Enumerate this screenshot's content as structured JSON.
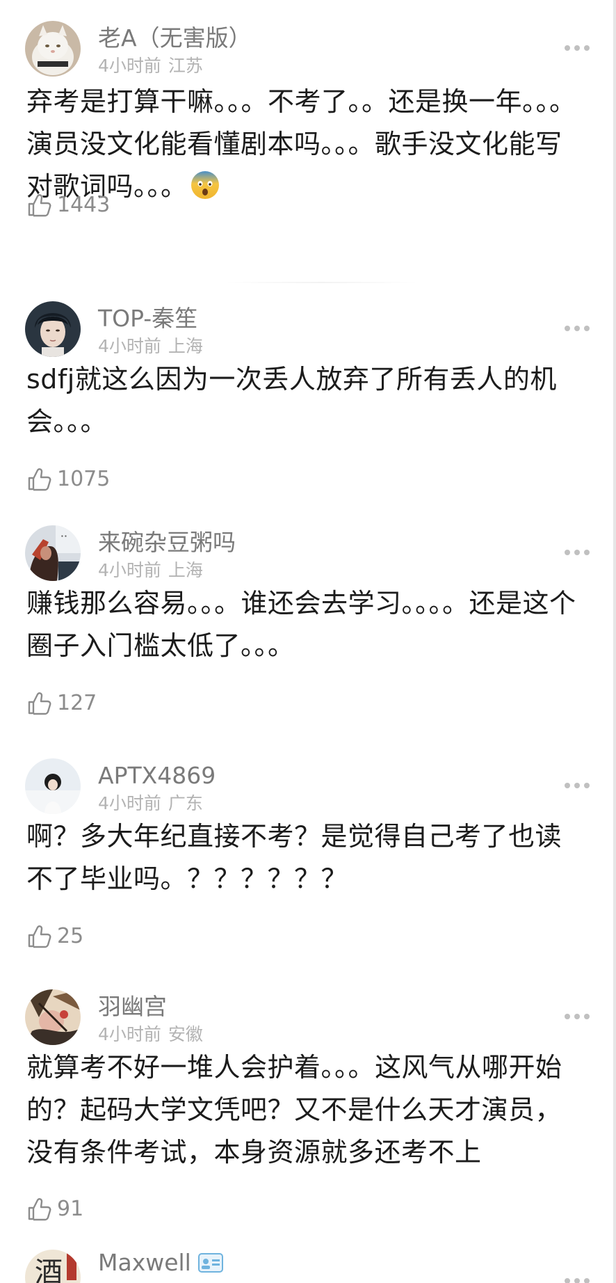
{
  "comments": [
    {
      "username": "老A（无害版）",
      "time": "4小时前",
      "location": "江苏",
      "text": "弃考是打算干嘛。。。不考了。。还是换一年。。。演员没文化能看懂剧本吗。。。歌手没文化能写对歌词吗。。。",
      "emoji": "fearful-face-emoji",
      "likes": "1443"
    },
    {
      "username": "TOP-秦笙",
      "time": "4小时前",
      "location": "上海",
      "text": "sdfj就这么因为一次丢人放弃了所有丢人的机会。。。",
      "likes": "1075"
    },
    {
      "username": "来碗杂豆粥吗",
      "time": "4小时前",
      "location": "上海",
      "text": "赚钱那么容易。。。谁还会去学习。。。。还是这个圈子入门槛太低了。。。",
      "likes": "127"
    },
    {
      "username": "APTX4869",
      "time": "4小时前",
      "location": "广东",
      "text": "啊？多大年纪直接不考？是觉得自己考了也读不了毕业吗。？？？？？？",
      "likes": "25"
    },
    {
      "username": "羽幽宫",
      "time": "4小时前",
      "location": "安徽",
      "text": "就算考不好一堆人会护着。。。这风气从哪开始的？起码大学文凭吧？又不是什么天才演员，没有条件考试，本身资源就多还考不上",
      "likes": "91"
    },
    {
      "username": "Maxwell",
      "badge": "id-card-badge-icon"
    }
  ],
  "colors": {
    "username": "#7a7a7a",
    "meta": "#b3b3b3",
    "body": "#1c1c1c",
    "likes": "#8c8c8c"
  }
}
